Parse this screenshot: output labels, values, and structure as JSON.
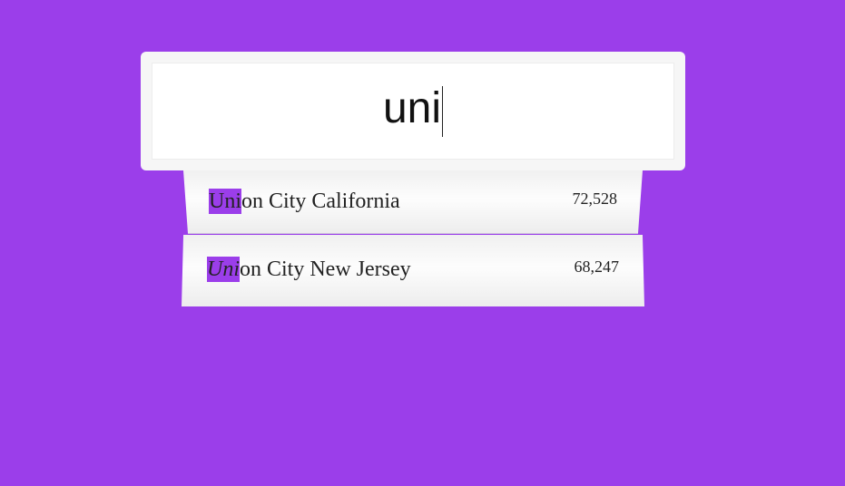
{
  "search": {
    "value": "uni"
  },
  "suggestions": [
    {
      "match": "Uni",
      "rest": "on City California",
      "population": "72,528"
    },
    {
      "match": "Uni",
      "rest": "on City New Jersey",
      "population": "68,247"
    }
  ],
  "colors": {
    "background": "#9b3eea",
    "highlight": "#9b3eea"
  }
}
